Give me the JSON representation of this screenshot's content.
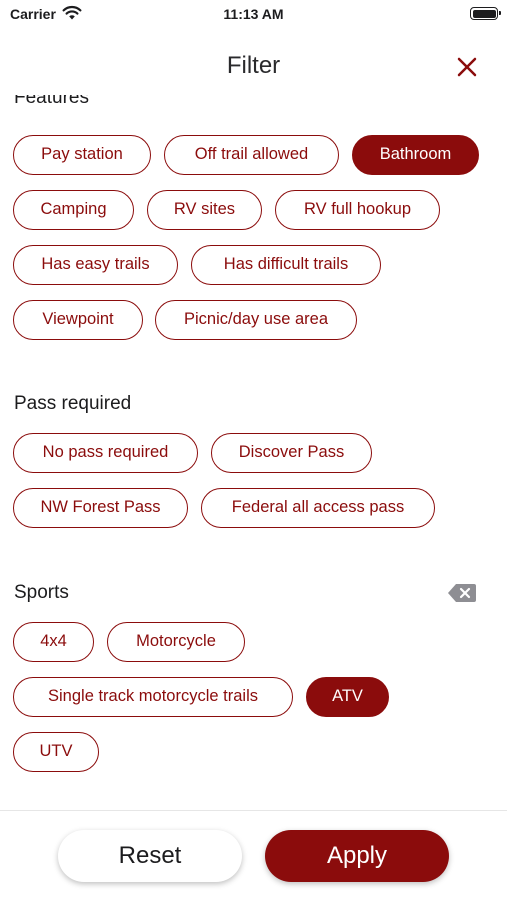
{
  "status_bar": {
    "carrier": "Carrier",
    "time": "11:13 AM",
    "icons": [
      "wifi-icon",
      "battery-icon"
    ]
  },
  "nav": {
    "title": "Filter",
    "close_icon": "close-icon"
  },
  "colors": {
    "accent": "#8b0c0c",
    "background": "#ffffff",
    "text": "#1c1c1e"
  },
  "sections": {
    "features": {
      "title": "Features",
      "chips": [
        {
          "label": "Pay station",
          "selected": false
        },
        {
          "label": "Off trail allowed",
          "selected": false
        },
        {
          "label": "Bathroom",
          "selected": true
        },
        {
          "label": "Camping",
          "selected": false
        },
        {
          "label": "RV sites",
          "selected": false
        },
        {
          "label": "RV full hookup",
          "selected": false
        },
        {
          "label": "Has easy trails",
          "selected": false
        },
        {
          "label": "Has difficult trails",
          "selected": false
        },
        {
          "label": "Viewpoint",
          "selected": false
        },
        {
          "label": "Picnic/day use area",
          "selected": false
        }
      ]
    },
    "pass": {
      "title": "Pass required",
      "chips": [
        {
          "label": "No pass required",
          "selected": false
        },
        {
          "label": "Discover Pass",
          "selected": false
        },
        {
          "label": "NW Forest Pass",
          "selected": false
        },
        {
          "label": "Federal all access pass",
          "selected": false
        }
      ]
    },
    "sports": {
      "title": "Sports",
      "clear_icon": "clear-backspace-icon",
      "chips": [
        {
          "label": "4x4",
          "selected": false
        },
        {
          "label": "Motorcycle",
          "selected": false
        },
        {
          "label": "Single track motorcycle trails",
          "selected": false
        },
        {
          "label": "ATV",
          "selected": true
        },
        {
          "label": "UTV",
          "selected": false
        }
      ]
    }
  },
  "footer": {
    "reset_label": "Reset",
    "apply_label": "Apply"
  }
}
